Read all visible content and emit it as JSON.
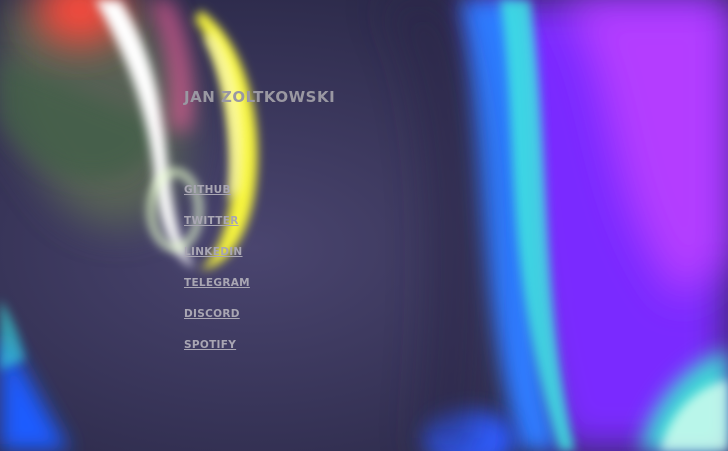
{
  "page": {
    "name": "JAN ZOLTKOWSKI",
    "links": [
      {
        "label": "GITHUB"
      },
      {
        "label": "TWITTER"
      },
      {
        "label": "LINKEDIN"
      },
      {
        "label": "TELEGRAM"
      },
      {
        "label": "DISCORD"
      },
      {
        "label": "SPOTIFY"
      }
    ]
  },
  "colors": {
    "background": "#3b3566",
    "accent_purple": "#8a2cff",
    "accent_yellow": "#f4f23a",
    "accent_cyan": "#38e0e0",
    "text": "#a9a6b3"
  }
}
